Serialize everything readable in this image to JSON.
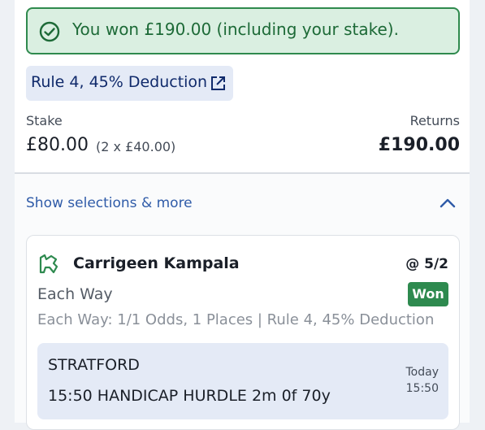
{
  "result": {
    "message": "You won £190.00 (including your stake).",
    "icon": "check-circle-icon",
    "color": "#2f8a4e"
  },
  "rule_chip": {
    "label": "Rule 4, 45% Deduction",
    "icon": "external-link-icon"
  },
  "stake": {
    "label": "Stake",
    "value": "£80.00",
    "detail": "(2 x £40.00)"
  },
  "returns": {
    "label": "Returns",
    "value": "£190.00"
  },
  "toggle": {
    "label": "Show selections & more",
    "icon": "chevron-up-icon"
  },
  "selection": {
    "icon": "horse-racing-icon",
    "name": "Carrigeen Kampala",
    "odds": "@ 5/2",
    "bet_type": "Each Way",
    "status": "Won",
    "terms": "Each Way: 1/1 Odds, 1 Places | Rule 4, 45% Deduction",
    "race": {
      "venue": "STRATFORD",
      "name": "15:50 HANDICAP HURDLE 2m 0f 70y",
      "day": "Today",
      "time": "15:50"
    }
  },
  "colors": {
    "success": "#2e8a4f",
    "link": "#2f5ba8",
    "chip_bg": "#e4eaf6"
  }
}
